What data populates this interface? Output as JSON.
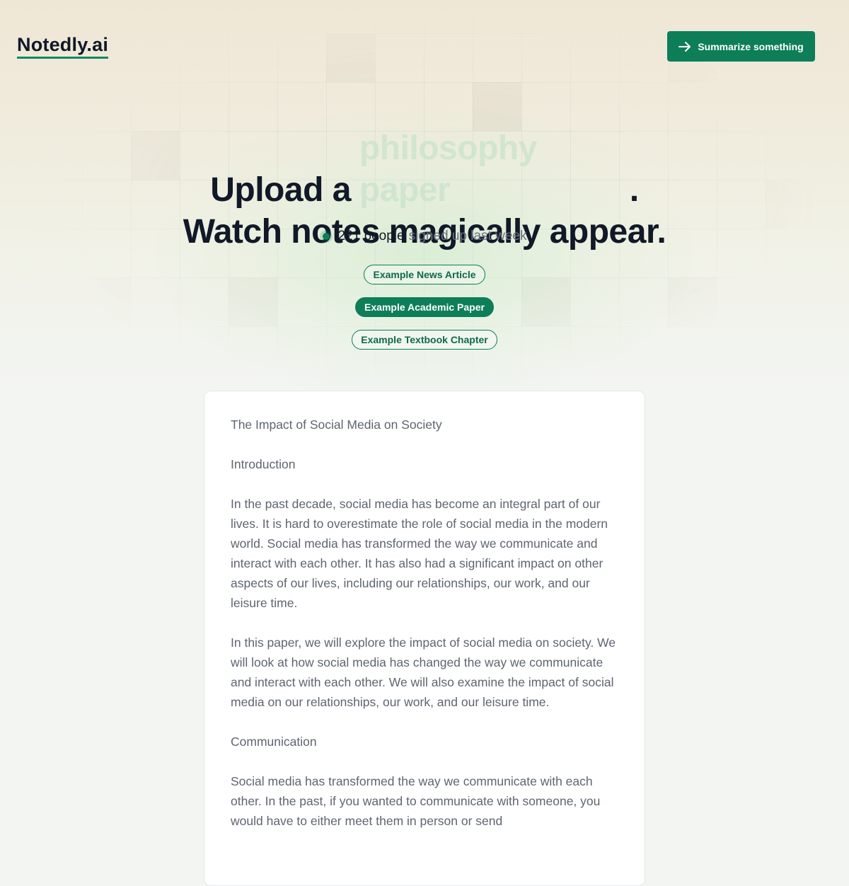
{
  "header": {
    "logo": "Notedly.ai",
    "cta_label": "Summarize something",
    "cta_icon": "arrow-right-icon"
  },
  "hero": {
    "line1_prefix": "Upload a",
    "rotating_word": "philosophy paper",
    "line1_suffix": ".",
    "line2": "Watch notes magically appear.",
    "signup_count": "221 people",
    "signup_rest": "signed up last week"
  },
  "examples": [
    {
      "label": "Example News Article",
      "active": false
    },
    {
      "label": "Example Academic Paper",
      "active": true
    },
    {
      "label": "Example Textbook Chapter",
      "active": false
    }
  ],
  "document": {
    "paragraphs": [
      "The Impact of Social Media on Society",
      "Introduction",
      "In the past decade, social media has become an integral part of our lives. It is hard to overestimate the role of social media in the modern world. Social media has transformed the way we communicate and interact with each other. It has also had a significant impact on other aspects of our lives, including our relationships, our work, and our leisure time.",
      "In this paper, we will explore the impact of social media on society. We will look at how social media has changed the way we communicate and interact with each other. We will also examine the impact of social media on our relationships, our work, and our leisure time.",
      "Communication",
      "Social media has transformed the way we communicate with each other. In the past, if you wanted to communicate with someone, you would have to either meet them in person or send"
    ]
  },
  "colors": {
    "brand": "#0d7e58",
    "heading": "#111827",
    "body_text": "#5f6570"
  }
}
